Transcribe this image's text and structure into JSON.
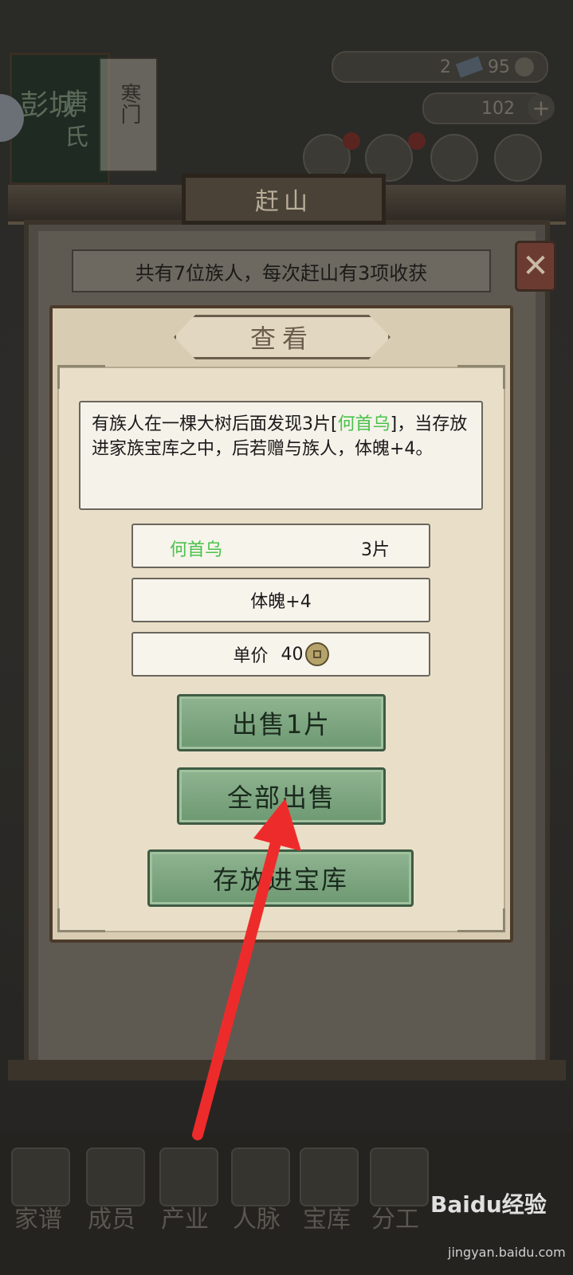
{
  "background": {
    "book_title": "彭城",
    "book_subtitle": "唐氏",
    "book_side": "寒门",
    "resource1_value": "2",
    "resource2_value": "95",
    "gold_value": "102"
  },
  "header": {
    "title": "赶山"
  },
  "info_bar": {
    "text": "共有7位族人，每次赶山有3项收获"
  },
  "close_button": {
    "icon": "close-icon"
  },
  "popup": {
    "title": "查看",
    "description_before": "有族人在一棵大树后面发现3片[",
    "description_item": "何首乌",
    "description_after": "]，当存放进家族宝库之中，后若赠与族人，体魄+4。",
    "item_name": "何首乌",
    "item_quantity": "3片",
    "effect": "体魄+4",
    "price_label": "单价",
    "price_value": "40",
    "price_icon": "coin-icon",
    "sell_one_label": "出售1片",
    "sell_all_label": "全部出售",
    "store_label": "存放进宝库"
  },
  "bottom_nav": {
    "items": [
      {
        "label": "家谱"
      },
      {
        "label": "成员"
      },
      {
        "label": "产业"
      },
      {
        "label": "人脉"
      },
      {
        "label": "宝库"
      },
      {
        "label": "分工"
      }
    ]
  },
  "watermark": {
    "text": "Baidu经验",
    "url_text": "jingyan.baidu.com"
  },
  "colors": {
    "item_highlight": "#4ac24a",
    "annotation_arrow": "#ee2b2b"
  }
}
